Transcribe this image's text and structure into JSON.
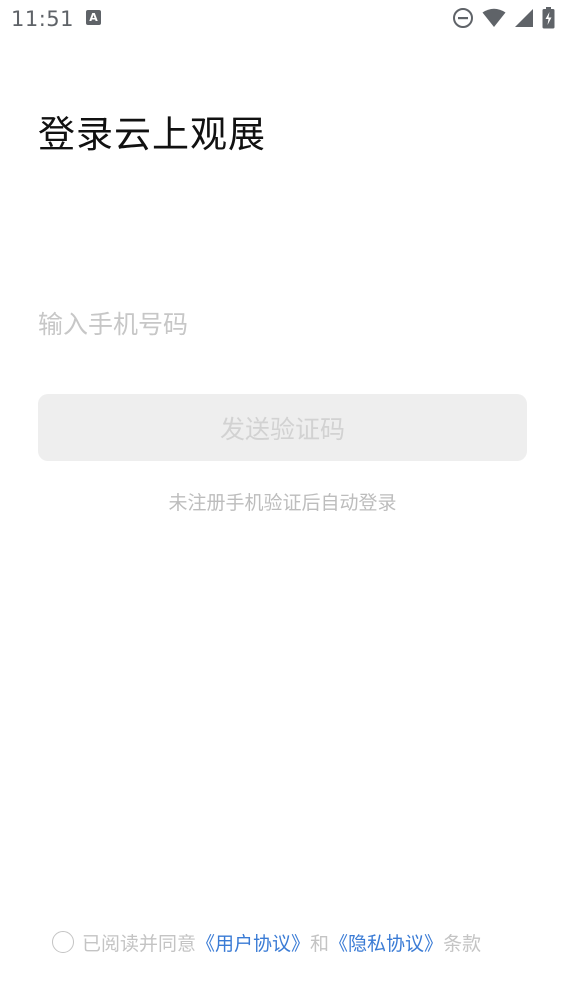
{
  "status_bar": {
    "time": "11:51",
    "notification_icon_letter": "A",
    "icons": [
      "dnd-icon",
      "wifi-icon",
      "signal-icon",
      "battery-icon"
    ]
  },
  "login": {
    "title": "登录云上观展",
    "phone_placeholder": "输入手机号码",
    "phone_value": "",
    "send_code_label": "发送验证码",
    "hint": "未注册手机验证后自动登录"
  },
  "agreement": {
    "prefix": "已阅读并同意",
    "user_agreement": "《用户协议》",
    "joiner": "和",
    "privacy_policy": "《隐私协议》",
    "suffix": "条款",
    "checked": false
  },
  "colors": {
    "link": "#3a7bd5",
    "button_bg": "#eeeeee",
    "button_text": "#d2d2d2",
    "muted_text": "#bdbdbd",
    "status_icon": "#5f6368"
  }
}
